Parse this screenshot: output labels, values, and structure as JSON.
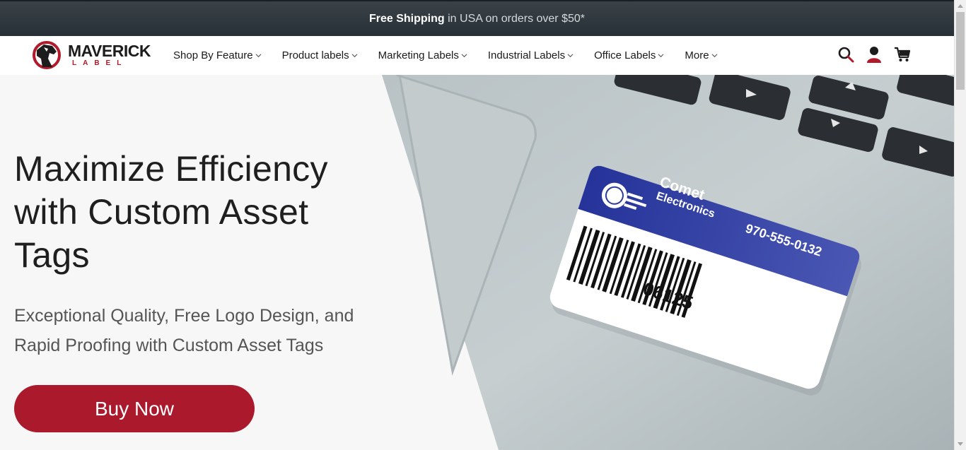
{
  "topbar": {
    "shipping_bold": "Free Shipping",
    "shipping_rest": "in USA on orders over $50*"
  },
  "logo": {
    "main": "MAVERICK",
    "sub": "LABEL",
    "icon": "horse-head-icon"
  },
  "menu": {
    "items": [
      {
        "label": "Shop By Feature"
      },
      {
        "label": "Product labels"
      },
      {
        "label": "Marketing Labels"
      },
      {
        "label": "Industrial Labels"
      },
      {
        "label": "Office Labels"
      },
      {
        "label": "More"
      }
    ]
  },
  "nav_icons": [
    "search-icon",
    "account-icon",
    "cart-icon"
  ],
  "hero": {
    "headline": "Maximize Efficiency with Custom Asset Tags",
    "subhead": "Exceptional Quality, Free Logo Design, and Rapid Proofing with Custom Asset Tags",
    "cta": "Buy Now",
    "tag": {
      "company_line1": "Comet",
      "company_line2": "Electronics",
      "phone": "970-555-0132",
      "number": "06125"
    }
  },
  "colors": {
    "accent": "#ab1a2c",
    "topbar": "#263036",
    "tag_blue": "#2e3d9c"
  }
}
